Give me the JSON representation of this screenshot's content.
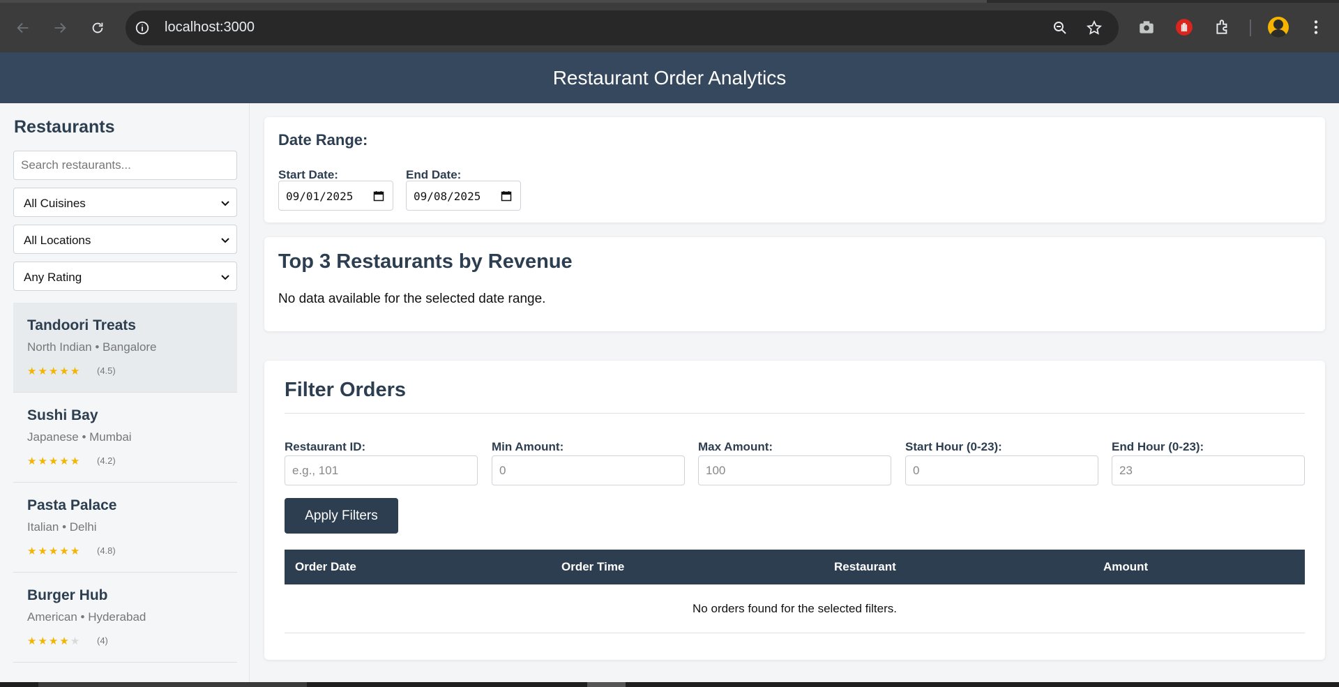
{
  "browser": {
    "url": "localhost:3000"
  },
  "app": {
    "title": "Restaurant Order Analytics"
  },
  "sidebar": {
    "heading": "Restaurants",
    "search_placeholder": "Search restaurants...",
    "filters": {
      "cuisine": "All Cuisines",
      "location": "All Locations",
      "rating": "Any Rating"
    },
    "restaurants": [
      {
        "name": "Tandoori Treats",
        "meta": "North Indian • Bangalore",
        "stars": 5,
        "rating": "(4.5)",
        "active": true
      },
      {
        "name": "Sushi Bay",
        "meta": "Japanese • Mumbai",
        "stars": 5,
        "rating": "(4.2)",
        "active": false
      },
      {
        "name": "Pasta Palace",
        "meta": "Italian • Delhi",
        "stars": 5,
        "rating": "(4.8)",
        "active": false
      },
      {
        "name": "Burger Hub",
        "meta": "American • Hyderabad",
        "stars": 4,
        "rating": "(4)",
        "active": false
      }
    ]
  },
  "date_range": {
    "heading": "Date Range:",
    "start_label": "Start Date:",
    "start_value": "09/01/2025",
    "end_label": "End Date:",
    "end_value": "09/08/2025"
  },
  "top_restaurants": {
    "heading": "Top 3 Restaurants by Revenue",
    "empty_message": "No data available for the selected date range."
  },
  "filter_orders": {
    "heading": "Filter Orders",
    "fields": {
      "restaurant_id": {
        "label": "Restaurant ID:",
        "placeholder": "e.g., 101"
      },
      "min_amount": {
        "label": "Min Amount:",
        "placeholder": "0"
      },
      "max_amount": {
        "label": "Max Amount:",
        "placeholder": "100"
      },
      "start_hour": {
        "label": "Start Hour (0-23):",
        "placeholder": "0"
      },
      "end_hour": {
        "label": "End Hour (0-23):",
        "placeholder": "23"
      }
    },
    "apply_label": "Apply Filters",
    "columns": [
      "Order Date",
      "Order Time",
      "Restaurant",
      "Amount"
    ],
    "empty_message": "No orders found for the selected filters."
  },
  "colors": {
    "header_bg": "#35485e",
    "primary": "#2c3e50",
    "star": "#f5b400"
  }
}
